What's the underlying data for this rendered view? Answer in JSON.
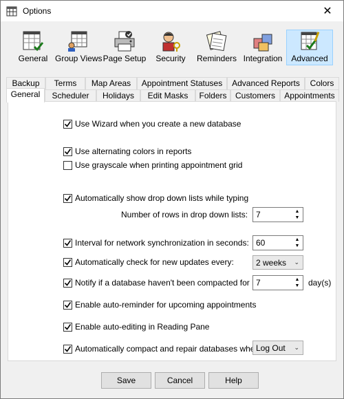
{
  "window": {
    "title": "Options",
    "close_label": "✕"
  },
  "toolbar": [
    {
      "label": "General",
      "icon": "calendar-check-icon"
    },
    {
      "label": "Group Views",
      "icon": "grid-people-icon"
    },
    {
      "label": "Page Setup",
      "icon": "printer-icon"
    },
    {
      "label": "Security",
      "icon": "user-key-icon"
    },
    {
      "label": "Reminders",
      "icon": "notes-icon"
    },
    {
      "label": "Integration",
      "icon": "blocks-icon"
    },
    {
      "label": "Advanced",
      "icon": "calendar-gear-icon"
    }
  ],
  "tabs_top": [
    "Backup",
    "Terms",
    "Map Areas",
    "Appointment Statuses",
    "Advanced Reports",
    "Colors"
  ],
  "tabs_bottom": [
    "General",
    "Scheduler",
    "Holidays",
    "Edit Masks",
    "Folders",
    "Customers",
    "Appointments"
  ],
  "options": {
    "wizard": "Use Wizard when you create a new database",
    "alt_colors": "Use alternating colors in reports",
    "grayscale": "Use grayscale when printing appointment grid",
    "dropdown": "Automatically show drop down lists while typing",
    "rows_label": "Number of rows in drop down lists:",
    "rows_value": "7",
    "interval": "Interval for network synchronization in seconds:",
    "interval_value": "60",
    "updates": "Automatically check for new updates every:",
    "updates_value": "2 weeks",
    "notify": "Notify if a database haven't been compacted for last",
    "notify_value": "7",
    "notify_unit": "day(s)",
    "reminder": "Enable auto-reminder for upcoming appointments",
    "editing": "Enable auto-editing in Reading Pane",
    "compact": "Automatically compact and repair databases when:",
    "compact_value": "Log Out"
  },
  "buttons": {
    "save": "Save",
    "cancel": "Cancel",
    "help": "Help"
  }
}
